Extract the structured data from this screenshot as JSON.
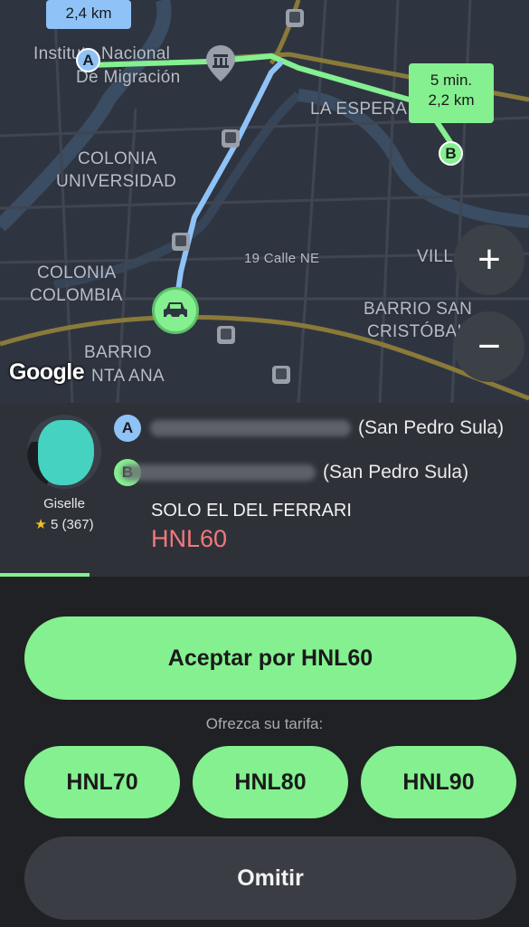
{
  "map": {
    "labels": {
      "instituto": "Instituto Nacional",
      "migracion": "De Migración",
      "la_espera": "LA ESPERA",
      "colonia_universidad_1": "COLONIA",
      "colonia_universidad_2": "UNIVERSIDAD",
      "calle": "19 Calle NE",
      "villa": "VILL",
      "colonia_colombia_1": "COLONIA",
      "colonia_colombia_2": "COLOMBIA",
      "barrio_san_1": "BARRIO SAN",
      "barrio_san_2": "CRISTÓBAL",
      "barrio_santa_1": "BARRIO",
      "barrio_santa_2": "NTA ANA"
    },
    "pickup_distance": "2,4 km",
    "dest_time": "5 min.",
    "dest_distance": "2,2 km",
    "pin_a": "A",
    "pin_b": "B",
    "google_logo": "Google",
    "zoom_in": "+",
    "zoom_out": "−",
    "route_colors": {
      "pickup": "#8fc3f7",
      "trip": "#84f090"
    },
    "icons": [
      "museum-icon",
      "bus-stop-icon",
      "car-icon"
    ]
  },
  "order": {
    "passenger_name": "Giselle",
    "rating": "5 (367)",
    "star": "★",
    "pickup_label": "A",
    "pickup_city": "(San Pedro Sula)",
    "dropoff_label": "B",
    "dropoff_city": "(San Pedro Sula)",
    "comment": "SOLO EL DEL FERRARI",
    "price": "HNL60",
    "timer_progress": 0.17
  },
  "actions": {
    "accept_label": "Aceptar por HNL60",
    "offer_label": "Ofrezca su tarifa:",
    "fares": [
      "HNL70",
      "HNL80",
      "HNL90"
    ],
    "skip_label": "Omitir"
  },
  "colors": {
    "accent": "#84f090",
    "price": "#f2787c",
    "pickup": "#8fc3f7",
    "background": "#202124"
  }
}
